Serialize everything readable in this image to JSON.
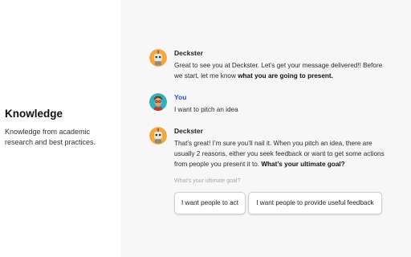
{
  "section": {
    "title": "Knowledge",
    "description": "Knowledge from academic research and best practices."
  },
  "messages": [
    {
      "sender": "Deckster",
      "text_plain": "Great to see you at Deckster. Let’s get your message delivered!! Before we start, let me know ",
      "text_bold": "what you are going to present."
    },
    {
      "sender": "You",
      "text_plain": "I want to pitch an idea",
      "text_bold": ""
    },
    {
      "sender": "Deckster",
      "text_plain": "That’s great! I’m sure you’ll nail it. When you pitch an idea, there are usually 2 reasons, either you seek feedback or want to get some actions from people you present it to. ",
      "text_bold": "What’s your ultimate goal?"
    }
  ],
  "prompt": {
    "placeholder": "What’s your ultimate goal?"
  },
  "choices": [
    "I want people to act",
    "I want people to provide useful feedback"
  ],
  "colors": {
    "chat_background": "#f7f7f7",
    "user_name": "#2d4bd6",
    "bot_avatar_bg": "#f2a93b",
    "user_avatar_bg": "#2bb3c0"
  },
  "icons": {
    "bot_avatar": "robot-avatar-icon",
    "user_avatar": "user-avatar-icon"
  }
}
